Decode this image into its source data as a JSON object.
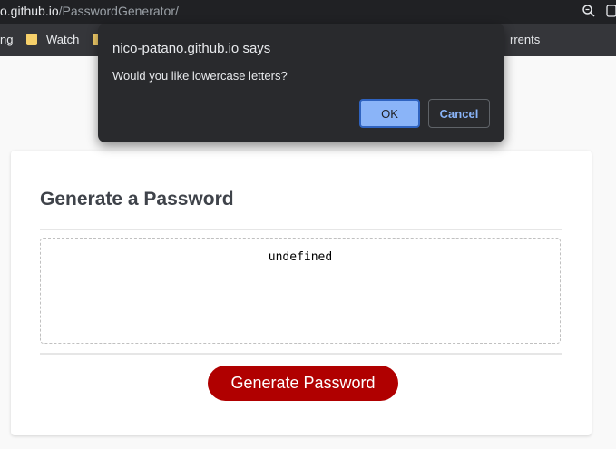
{
  "browser": {
    "url_host": "o.github.io",
    "url_path": "/PasswordGenerator/",
    "zoom_icon": "zoom-icon",
    "bookmarks": [
      {
        "label": "ng",
        "icon": ""
      },
      {
        "label": "Watch",
        "icon": "folder-icon"
      },
      {
        "label": "",
        "icon": "folder-icon"
      },
      {
        "label": "rrents",
        "icon": ""
      }
    ]
  },
  "dialog": {
    "title": "nico-patano.github.io says",
    "message": "Would you like lowercase letters?",
    "ok_label": "OK",
    "cancel_label": "Cancel"
  },
  "page": {
    "heading": "Generate a Password",
    "password_value": "undefined",
    "generate_label": "Generate Password"
  },
  "colors": {
    "accent_button": "#b00000",
    "dialog_ok": "#8ab4f8",
    "chrome_dark": "#202124"
  }
}
